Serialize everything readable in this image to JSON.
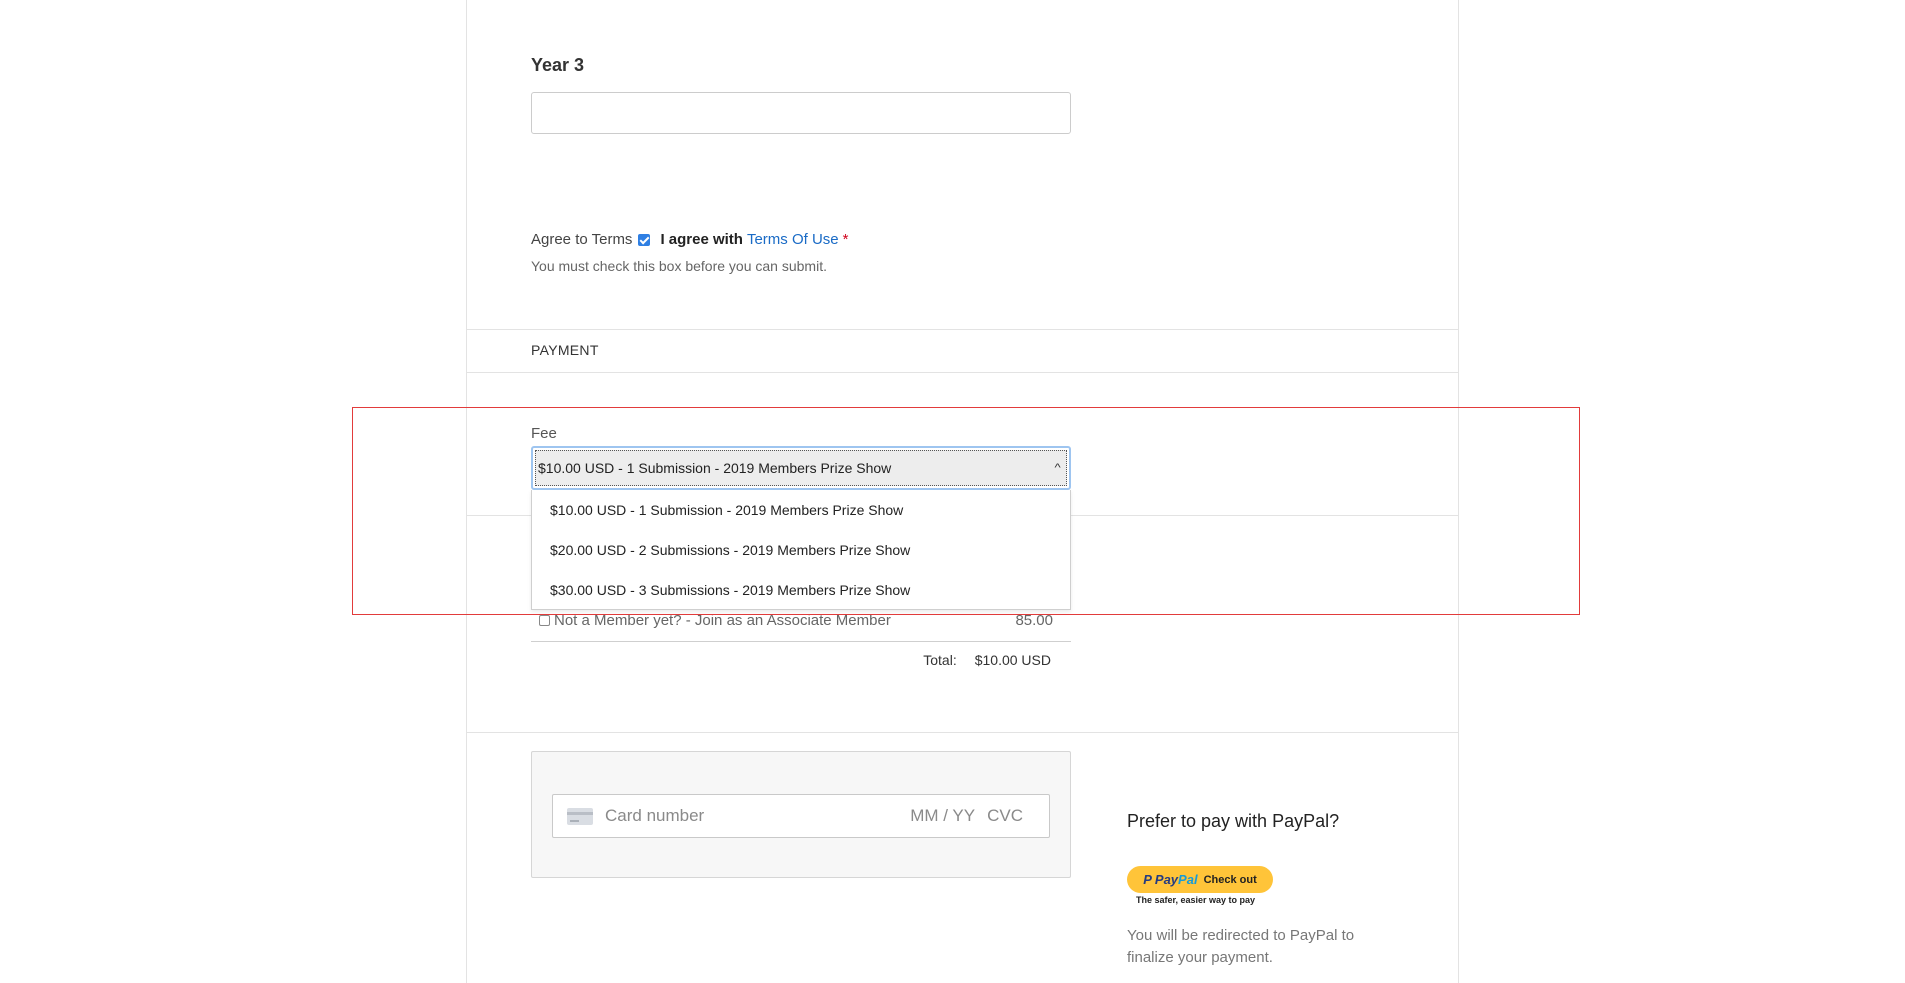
{
  "form": {
    "year_label": "Year 3",
    "year_value": "",
    "terms": {
      "label": "Agree to Terms",
      "checked": true,
      "agree_text": "I agree with",
      "link_text": "Terms Of Use",
      "required_mark": "*",
      "help_text": "You must check this box before you can submit."
    },
    "payment": {
      "section_title": "PAYMENT",
      "fee_label": "Fee",
      "fee_selected": "$10.00 USD - 1 Submission - 2019 Members Prize Show",
      "fee_options": [
        "$10.00 USD - 1 Submission - 2019 Members Prize Show",
        "$20.00 USD - 2 Submissions - 2019 Members Prize Show",
        "$30.00 USD - 3 Submissions - 2019 Members Prize Show"
      ],
      "addon_label": "Not a Member yet? - Join as an Associate Member",
      "addon_price": "85.00",
      "addon_checked": false,
      "total_label": "Total:",
      "total_value": "$10.00 USD"
    },
    "card": {
      "number_placeholder": "Card number",
      "expiry_placeholder": "MM / YY",
      "cvc_placeholder": "CVC",
      "icon": "credit-card-icon"
    },
    "paypal": {
      "prompt": "Prefer to pay with PayPal?",
      "logo_pay": "Pay",
      "logo_pal": "Pal",
      "button_label": "Check out",
      "tagline": "The safer, easier way to pay",
      "note": "You will be redirected to PayPal to finalize your payment.",
      "button_color": "#ffc439"
    }
  },
  "colors": {
    "link": "#1a6bc6",
    "required": "#d0021b",
    "checkbox": "#2f7fe3",
    "highlight_border": "#e23b3b"
  }
}
